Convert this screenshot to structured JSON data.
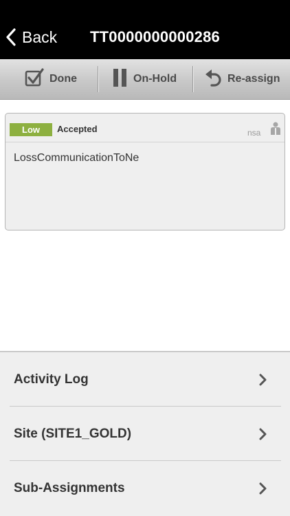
{
  "nav": {
    "back_label": "Back",
    "title": "TT0000000000286"
  },
  "toolbar": {
    "done_label": "Done",
    "onhold_label": "On-Hold",
    "reassign_label": "Re-assign"
  },
  "ticket": {
    "priority": "Low",
    "priority_color": "#8db040",
    "status": "Accepted",
    "tag": "nsa",
    "description": "LossCommunicationToNe"
  },
  "links": [
    {
      "label": "Activity Log"
    },
    {
      "label": "Site (SITE1_GOLD)"
    },
    {
      "label": "Sub-Assignments"
    }
  ],
  "icons": {
    "back": "chevron-left-icon",
    "done": "checkbox-checked-icon",
    "onhold": "pause-icon",
    "reassign": "undo-arrow-icon",
    "assignee": "person-icon",
    "row_chevron": "chevron-right-icon"
  }
}
